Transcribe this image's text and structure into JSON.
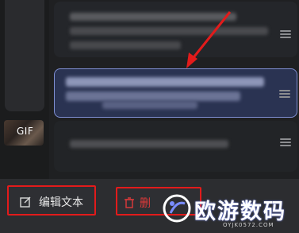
{
  "colors": {
    "highlight_border": "#7f8fd3",
    "annotation_red": "#e21b1b",
    "delete_red": "#e03a3a"
  },
  "sidebar": {
    "gif_badge": "GIF"
  },
  "clipboard": {
    "items": [
      {
        "name": "clip-item-1",
        "state": "blurred"
      },
      {
        "name": "clip-item-2",
        "state": "selected-blurred"
      },
      {
        "name": "clip-item-3",
        "state": "blurred"
      }
    ]
  },
  "actions": {
    "edit_label": "编辑文本",
    "edit_icon": "edit-icon",
    "delete_label": "删",
    "delete_icon": "trash-icon"
  },
  "watermark": {
    "title": "欧游数码",
    "subtitle": "OYJK0572.COM"
  }
}
